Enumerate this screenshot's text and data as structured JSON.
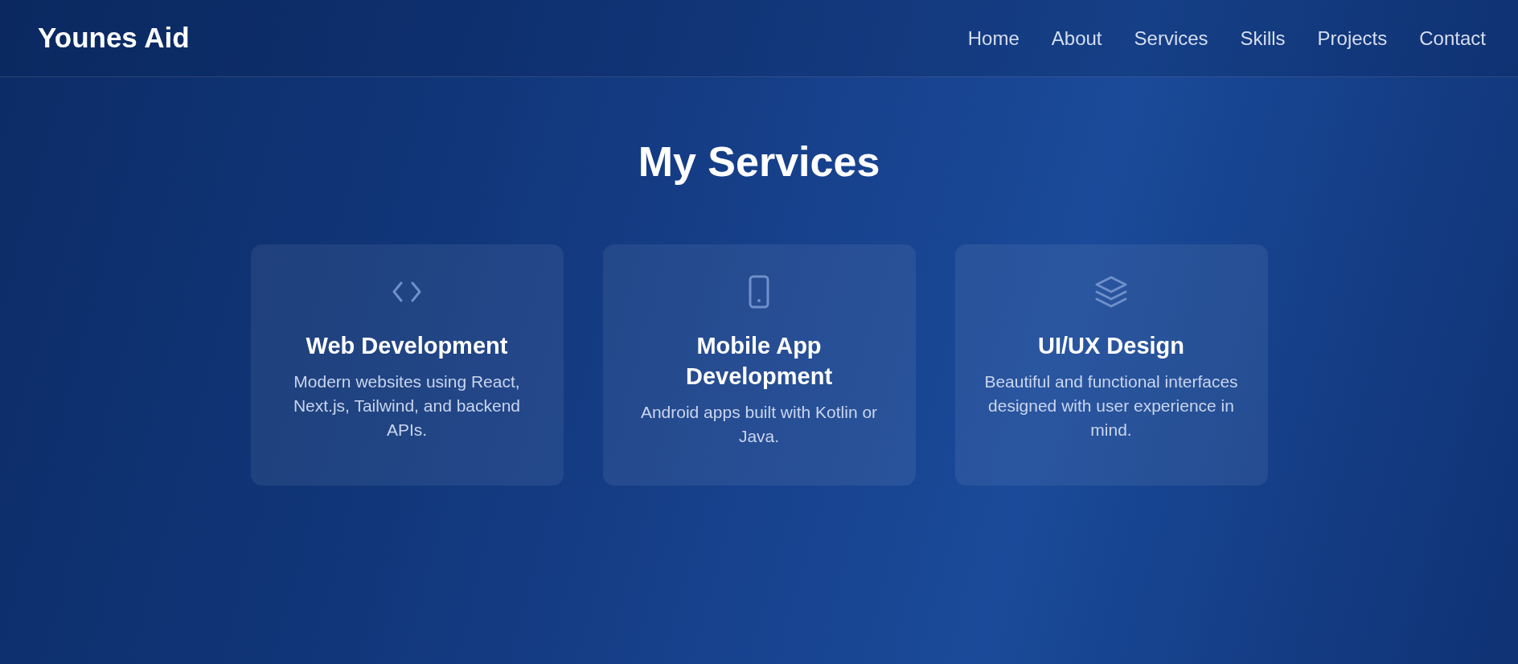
{
  "navbar": {
    "brand": "Younes Aid",
    "links": [
      "Home",
      "About",
      "Services",
      "Skills",
      "Projects",
      "Contact"
    ]
  },
  "services": {
    "title": "My Services",
    "cards": [
      {
        "kind": "web",
        "title": "Web Development",
        "description": "Modern websites using React, Next.js, Tailwind, and backend APIs."
      },
      {
        "kind": "mobile",
        "title": "Mobile App Development",
        "description": "Android apps built with Kotlin or Java."
      },
      {
        "kind": "design",
        "title": "UI/UX Design",
        "description": "Beautiful and functional interfaces designed with user experience in mind."
      }
    ]
  }
}
